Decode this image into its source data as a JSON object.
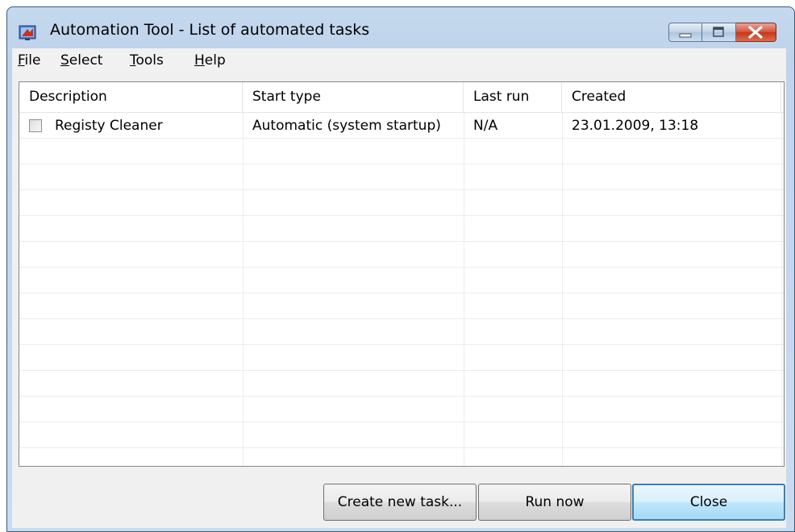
{
  "window": {
    "title": "Automation Tool - List of automated tasks",
    "icon": "app-icon"
  },
  "menu": [
    {
      "key": "F",
      "rest": "ile"
    },
    {
      "key": "S",
      "rest": "elect"
    },
    {
      "key": "T",
      "rest": "ools"
    },
    {
      "key": "H",
      "rest": "elp"
    }
  ],
  "columns": [
    "Description",
    "Start type",
    "Last run",
    "Created"
  ],
  "rows": [
    {
      "checked": false,
      "description": "Registy Cleaner",
      "start_type": "Automatic (system startup)",
      "last_run": "N/A",
      "created": "23.01.2009, 13:18"
    }
  ],
  "buttons": {
    "create": "Create new task...",
    "run": "Run now",
    "close": "Close"
  },
  "colors": {
    "window_frame": "#c4d8ee",
    "close_button": "#c4361c",
    "focus_border": "#3c7fb1"
  }
}
